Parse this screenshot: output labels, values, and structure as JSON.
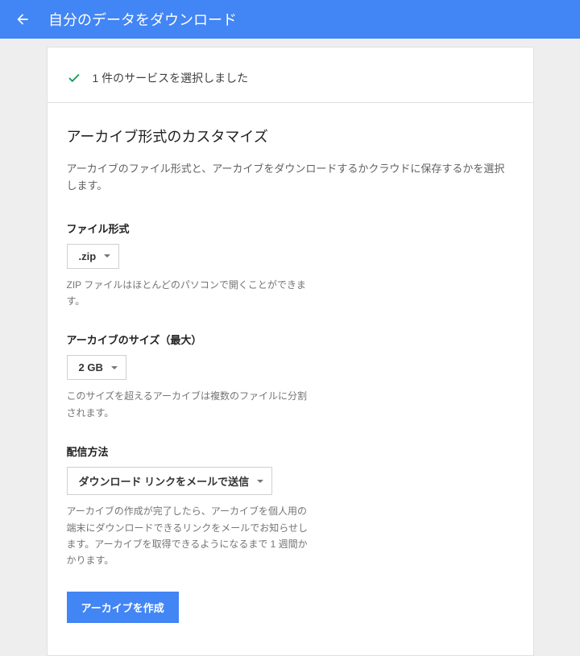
{
  "header": {
    "title": "自分のデータをダウンロード"
  },
  "selected": {
    "text": "1 件のサービスを選択しました"
  },
  "customize": {
    "title": "アーカイブ形式のカスタマイズ",
    "description": "アーカイブのファイル形式と、アーカイブをダウンロードするかクラウドに保存するかを選択します。"
  },
  "fileFormat": {
    "label": "ファイル形式",
    "value": ".zip",
    "help": "ZIP ファイルはほとんどのパソコンで開くことができます。"
  },
  "archiveSize": {
    "label": "アーカイブのサイズ（最大）",
    "value": "2 GB",
    "help": "このサイズを超えるアーカイブは複数のファイルに分割されます。"
  },
  "delivery": {
    "label": "配信方法",
    "value": "ダウンロード リンクをメールで送信",
    "help": "アーカイブの作成が完了したら、アーカイブを個人用の端末にダウンロードできるリンクをメールでお知らせします。アーカイブを取得できるようになるまで 1 週間かかります。"
  },
  "createButton": {
    "label": "アーカイブを作成"
  }
}
